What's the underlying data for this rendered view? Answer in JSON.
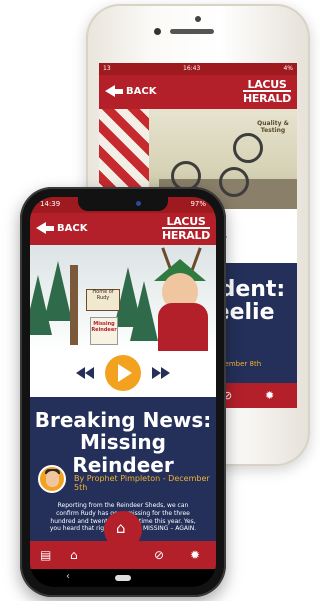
{
  "back_phone": {
    "status": {
      "carrier": "13",
      "time": "16:43",
      "battery": "4%"
    },
    "header": {
      "back_label": "BACK",
      "logo_line1": "LACUS",
      "logo_line2": "HERALD"
    },
    "illustration_text": "Quality & Testing",
    "article": {
      "title_lines": [
        "cident:",
        "heelie",
        "p"
      ],
      "date": "December 8th"
    }
  },
  "front_phone": {
    "status": {
      "time": "14:39",
      "battery": "97%"
    },
    "header": {
      "back_label": "BACK",
      "logo_line1": "LACUS",
      "logo_line2": "HERALD"
    },
    "illustration": {
      "sign_text": "Home of Rudy",
      "poster_text": "Missing Reindeer"
    },
    "article": {
      "title_line1": "Breaking News:",
      "title_line2": "Missing Reindeer",
      "byline": "By Prophet Pimpleton - December 5th",
      "body": "Reporting from the Reindeer Sheds, we can confirm Rudy has gone missing for the three hundred and twenty seventh time this year. Yes, you heard that right – RUDY IS MISSING – AGAIN."
    }
  },
  "colors": {
    "header_red": "#b3202a",
    "navy": "#24305a",
    "accent_yellow": "#f2b233",
    "play_orange": "#f2a21f"
  }
}
